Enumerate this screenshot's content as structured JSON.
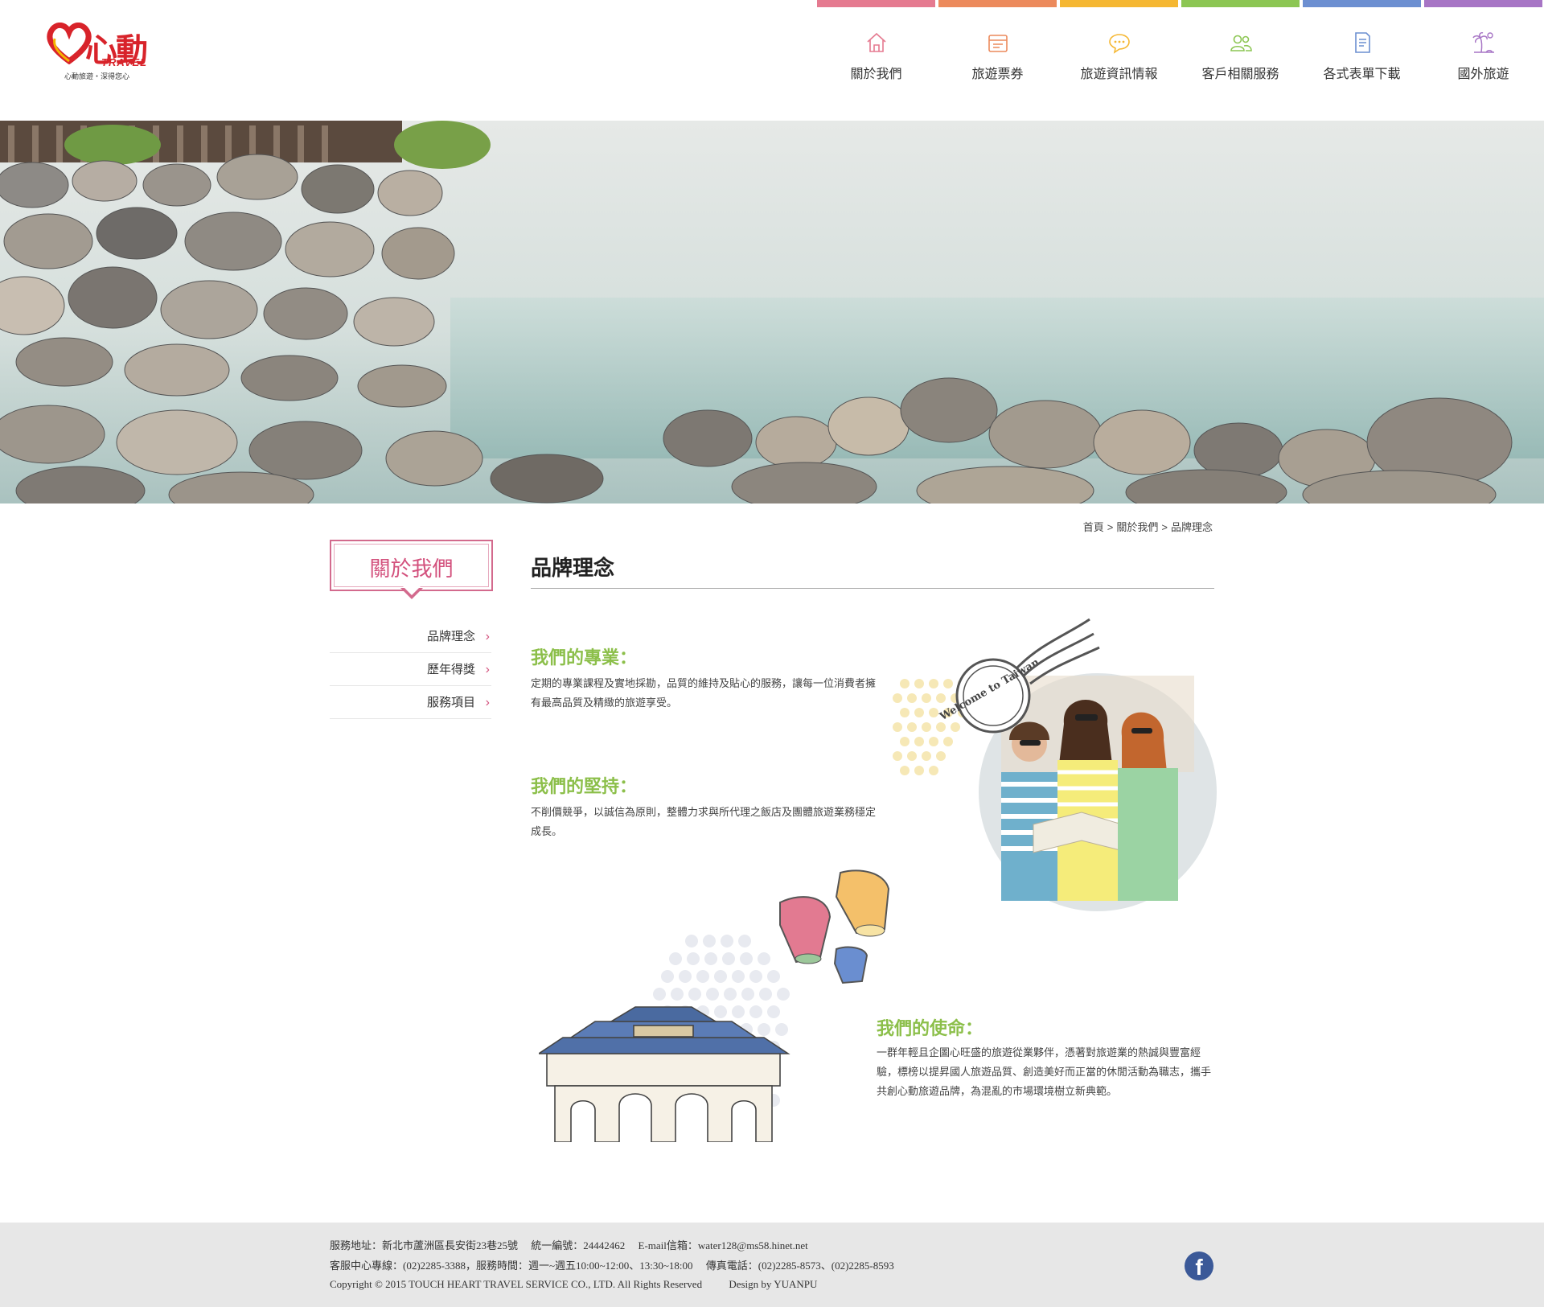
{
  "brand": {
    "logo_text": "心動",
    "logo_sub": "TRAVEL",
    "slogan": "心動旅遊・深得您心"
  },
  "nav": {
    "items": [
      {
        "label": "關於我們",
        "icon": "home-icon",
        "color": "#e57a90"
      },
      {
        "label": "旅遊票券",
        "icon": "ticket-icon",
        "color": "#ec8a5c"
      },
      {
        "label": "旅遊資訊情報",
        "icon": "chat-bubble-icon",
        "color": "#f5b732"
      },
      {
        "label": "客戶相關服務",
        "icon": "people-icon",
        "color": "#8cc653"
      },
      {
        "label": "各式表單下載",
        "icon": "document-icon",
        "color": "#6c8fd1"
      },
      {
        "label": "國外旅遊",
        "icon": "palm-tree-icon",
        "color": "#a775c5"
      }
    ]
  },
  "breadcrumb": {
    "home": "首頁",
    "sep": ">",
    "parent": "關於我們",
    "current": "品牌理念"
  },
  "sidebar": {
    "title": "關於我們",
    "items": [
      {
        "label": "品牌理念"
      },
      {
        "label": "歷年得獎"
      },
      {
        "label": "服務項目"
      }
    ],
    "chevron": "›"
  },
  "main": {
    "title": "品牌理念",
    "sections": [
      {
        "heading": "我們的專業：",
        "body": "定期的專業課程及實地採勘，品質的維持及貼心的服務，讓每一位消費者擁有最高品質及精緻的旅遊享受。"
      },
      {
        "heading": "我們的堅持：",
        "body": "不削價競爭，以誠信為原則，整體力求與所代理之飯店及團體旅遊業務穩定成長。"
      },
      {
        "heading": "我們的使命：",
        "body": "一群年輕且企圖心旺盛的旅遊從業夥伴，憑著對旅遊業的熱誠與豐富經驗，標榜以提昇國人旅遊品質、創造美好而正當的休閒活動為職志，攜手共創心動旅遊品牌，為混亂的市場環境樹立新典範。"
      }
    ],
    "stamp_text": "Welcome to Taiwan"
  },
  "footer": {
    "line1": "服務地址：新北市蘆洲區長安街23巷25號　 統一編號：24442462 　E-mail信箱：water128@ms58.hinet.net",
    "line2": "客服中心專線：(02)2285-3388，服務時間：週一~週五10:00~12:00、13:30~18:00 　傳真電話：(02)2285-8573、(02)2285-8593",
    "copyright": "Copyright © 2015 TOUCH HEART TRAVEL SERVICE CO., LTD. All Rights Reserved",
    "design": "Design by YUANPU",
    "fb_glyph": "f"
  },
  "colors": {
    "accent_pink": "#d3517d",
    "section_green": "#8cbf4a",
    "footer_bg": "#e7e7e7"
  }
}
